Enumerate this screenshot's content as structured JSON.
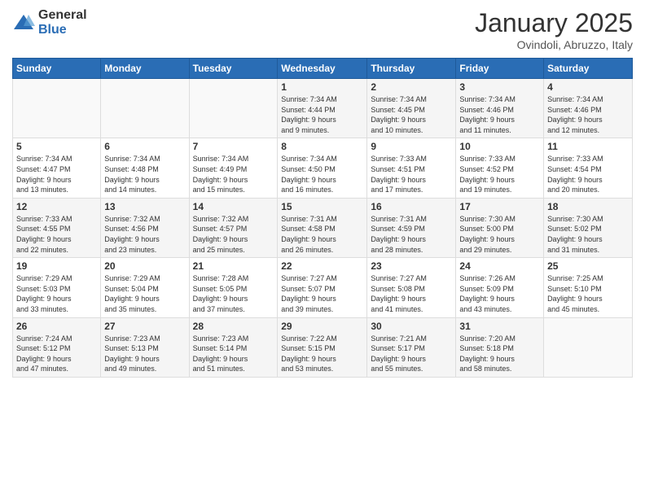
{
  "logo": {
    "general": "General",
    "blue": "Blue"
  },
  "header": {
    "month": "January 2025",
    "location": "Ovindoli, Abruzzo, Italy"
  },
  "weekdays": [
    "Sunday",
    "Monday",
    "Tuesday",
    "Wednesday",
    "Thursday",
    "Friday",
    "Saturday"
  ],
  "weeks": [
    [
      {
        "day": "",
        "info": ""
      },
      {
        "day": "",
        "info": ""
      },
      {
        "day": "",
        "info": ""
      },
      {
        "day": "1",
        "info": "Sunrise: 7:34 AM\nSunset: 4:44 PM\nDaylight: 9 hours\nand 9 minutes."
      },
      {
        "day": "2",
        "info": "Sunrise: 7:34 AM\nSunset: 4:45 PM\nDaylight: 9 hours\nand 10 minutes."
      },
      {
        "day": "3",
        "info": "Sunrise: 7:34 AM\nSunset: 4:46 PM\nDaylight: 9 hours\nand 11 minutes."
      },
      {
        "day": "4",
        "info": "Sunrise: 7:34 AM\nSunset: 4:46 PM\nDaylight: 9 hours\nand 12 minutes."
      }
    ],
    [
      {
        "day": "5",
        "info": "Sunrise: 7:34 AM\nSunset: 4:47 PM\nDaylight: 9 hours\nand 13 minutes."
      },
      {
        "day": "6",
        "info": "Sunrise: 7:34 AM\nSunset: 4:48 PM\nDaylight: 9 hours\nand 14 minutes."
      },
      {
        "day": "7",
        "info": "Sunrise: 7:34 AM\nSunset: 4:49 PM\nDaylight: 9 hours\nand 15 minutes."
      },
      {
        "day": "8",
        "info": "Sunrise: 7:34 AM\nSunset: 4:50 PM\nDaylight: 9 hours\nand 16 minutes."
      },
      {
        "day": "9",
        "info": "Sunrise: 7:33 AM\nSunset: 4:51 PM\nDaylight: 9 hours\nand 17 minutes."
      },
      {
        "day": "10",
        "info": "Sunrise: 7:33 AM\nSunset: 4:52 PM\nDaylight: 9 hours\nand 19 minutes."
      },
      {
        "day": "11",
        "info": "Sunrise: 7:33 AM\nSunset: 4:54 PM\nDaylight: 9 hours\nand 20 minutes."
      }
    ],
    [
      {
        "day": "12",
        "info": "Sunrise: 7:33 AM\nSunset: 4:55 PM\nDaylight: 9 hours\nand 22 minutes."
      },
      {
        "day": "13",
        "info": "Sunrise: 7:32 AM\nSunset: 4:56 PM\nDaylight: 9 hours\nand 23 minutes."
      },
      {
        "day": "14",
        "info": "Sunrise: 7:32 AM\nSunset: 4:57 PM\nDaylight: 9 hours\nand 25 minutes."
      },
      {
        "day": "15",
        "info": "Sunrise: 7:31 AM\nSunset: 4:58 PM\nDaylight: 9 hours\nand 26 minutes."
      },
      {
        "day": "16",
        "info": "Sunrise: 7:31 AM\nSunset: 4:59 PM\nDaylight: 9 hours\nand 28 minutes."
      },
      {
        "day": "17",
        "info": "Sunrise: 7:30 AM\nSunset: 5:00 PM\nDaylight: 9 hours\nand 29 minutes."
      },
      {
        "day": "18",
        "info": "Sunrise: 7:30 AM\nSunset: 5:02 PM\nDaylight: 9 hours\nand 31 minutes."
      }
    ],
    [
      {
        "day": "19",
        "info": "Sunrise: 7:29 AM\nSunset: 5:03 PM\nDaylight: 9 hours\nand 33 minutes."
      },
      {
        "day": "20",
        "info": "Sunrise: 7:29 AM\nSunset: 5:04 PM\nDaylight: 9 hours\nand 35 minutes."
      },
      {
        "day": "21",
        "info": "Sunrise: 7:28 AM\nSunset: 5:05 PM\nDaylight: 9 hours\nand 37 minutes."
      },
      {
        "day": "22",
        "info": "Sunrise: 7:27 AM\nSunset: 5:07 PM\nDaylight: 9 hours\nand 39 minutes."
      },
      {
        "day": "23",
        "info": "Sunrise: 7:27 AM\nSunset: 5:08 PM\nDaylight: 9 hours\nand 41 minutes."
      },
      {
        "day": "24",
        "info": "Sunrise: 7:26 AM\nSunset: 5:09 PM\nDaylight: 9 hours\nand 43 minutes."
      },
      {
        "day": "25",
        "info": "Sunrise: 7:25 AM\nSunset: 5:10 PM\nDaylight: 9 hours\nand 45 minutes."
      }
    ],
    [
      {
        "day": "26",
        "info": "Sunrise: 7:24 AM\nSunset: 5:12 PM\nDaylight: 9 hours\nand 47 minutes."
      },
      {
        "day": "27",
        "info": "Sunrise: 7:23 AM\nSunset: 5:13 PM\nDaylight: 9 hours\nand 49 minutes."
      },
      {
        "day": "28",
        "info": "Sunrise: 7:23 AM\nSunset: 5:14 PM\nDaylight: 9 hours\nand 51 minutes."
      },
      {
        "day": "29",
        "info": "Sunrise: 7:22 AM\nSunset: 5:15 PM\nDaylight: 9 hours\nand 53 minutes."
      },
      {
        "day": "30",
        "info": "Sunrise: 7:21 AM\nSunset: 5:17 PM\nDaylight: 9 hours\nand 55 minutes."
      },
      {
        "day": "31",
        "info": "Sunrise: 7:20 AM\nSunset: 5:18 PM\nDaylight: 9 hours\nand 58 minutes."
      },
      {
        "day": "",
        "info": ""
      }
    ]
  ]
}
